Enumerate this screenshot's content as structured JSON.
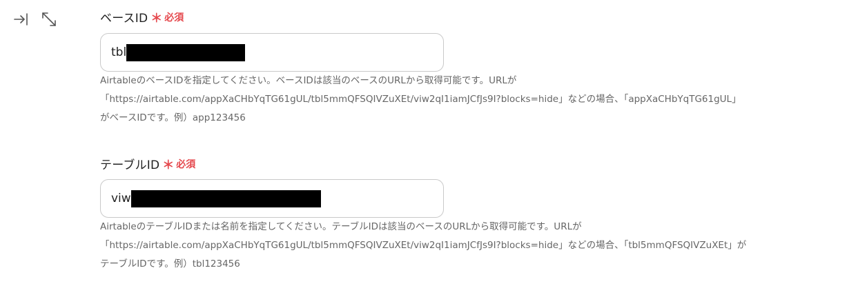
{
  "toolbar": {
    "collapse_icon": "collapse-to-right-icon",
    "expand_icon": "expand-diagonal-icon"
  },
  "colors": {
    "required": "#e5484d",
    "input_border": "#c9c9c9",
    "help_text": "#666666"
  },
  "base_field": {
    "label": "ベースID",
    "required_mark": "＊",
    "required_text": "必須",
    "value": "tbl",
    "help_lines": [
      "AirtableのベースIDを指定してください。ベースIDは該当のベースのURLから取得可能です。URLが",
      "「https://airtable.com/appXaCHbYqTG61gUL/tbl5mmQFSQIVZuXEt/viw2qI1iamJCfJs9I?blocks=hide」などの場合、「appXaCHbYqTG61gUL」",
      "がベースIDです。例）app123456"
    ]
  },
  "table_field": {
    "label": "テーブルID",
    "required_mark": "＊",
    "required_text": "必須",
    "value": "viw",
    "help_lines": [
      "AirtableのテーブルIDまたは名前を指定してください。テーブルIDは該当のベースのURLから取得可能です。URLが",
      "「https://airtable.com/appXaCHbYqTG61gUL/tbl5mmQFSQIVZuXEt/viw2qI1iamJCfJs9I?blocks=hide」などの場合、「tbl5mmQFSQIVZuXEt」が",
      "テーブルIDです。例）tbl123456"
    ]
  }
}
